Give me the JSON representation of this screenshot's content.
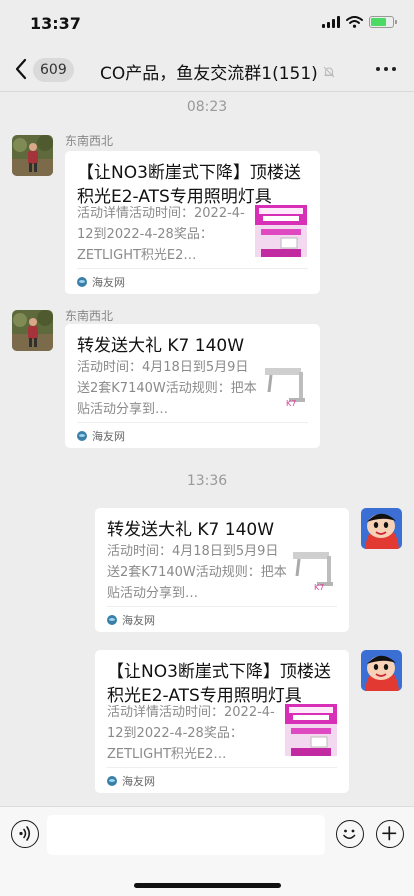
{
  "status_bar": {
    "time": "13:37",
    "icons": [
      "signal-icon",
      "wifi-icon",
      "battery-charging-icon"
    ],
    "battery_level": 0.7,
    "battery_color": "#4cd964"
  },
  "nav": {
    "unread_count": "609",
    "title": "CO产品，鱼友交流群1(151)",
    "icons": [
      "back-arrow-icon",
      "mute-bell-icon",
      "more-icon"
    ]
  },
  "messages": [
    {
      "type": "time",
      "text": "08:23"
    },
    {
      "type": "card",
      "side": "left",
      "sender": "东南西北",
      "title": "【让NO3断崖式下降】顶楼送积光E2-ATS专用照明灯具",
      "desc": "活动详情活动时间：2022-4-12到2022-4-28奖品：ZETLIGHT积光E2…",
      "source": "海友网"
    },
    {
      "type": "card",
      "side": "left",
      "sender": "东南西北",
      "title": "转发送大礼 K7 140W",
      "desc": "活动时间：4月18日到5月9日送2套K7140W活动规则：把本贴活动分享到…",
      "source": "海友网"
    },
    {
      "type": "time",
      "text": "13:36"
    },
    {
      "type": "card",
      "side": "right",
      "title": "转发送大礼 K7 140W",
      "desc": "活动时间：4月18日到5月9日送2套K7140W活动规则：把本贴活动分享到…",
      "source": "海友网"
    },
    {
      "type": "card",
      "side": "right",
      "title": "【让NO3断崖式下降】顶楼送积光E2-ATS专用照明灯具",
      "desc": "活动详情活动时间：2022-4-12到2022-4-28奖品：ZETLIGHT积光E2…",
      "source": "海友网"
    }
  ],
  "input_bar": {
    "value": "",
    "icons": [
      "voice-icon",
      "emoji-icon",
      "plus-icon"
    ]
  },
  "colors": {
    "background": "#ededed",
    "card": "#ffffff",
    "secondary_text": "#888888",
    "badge": "#dadada"
  }
}
